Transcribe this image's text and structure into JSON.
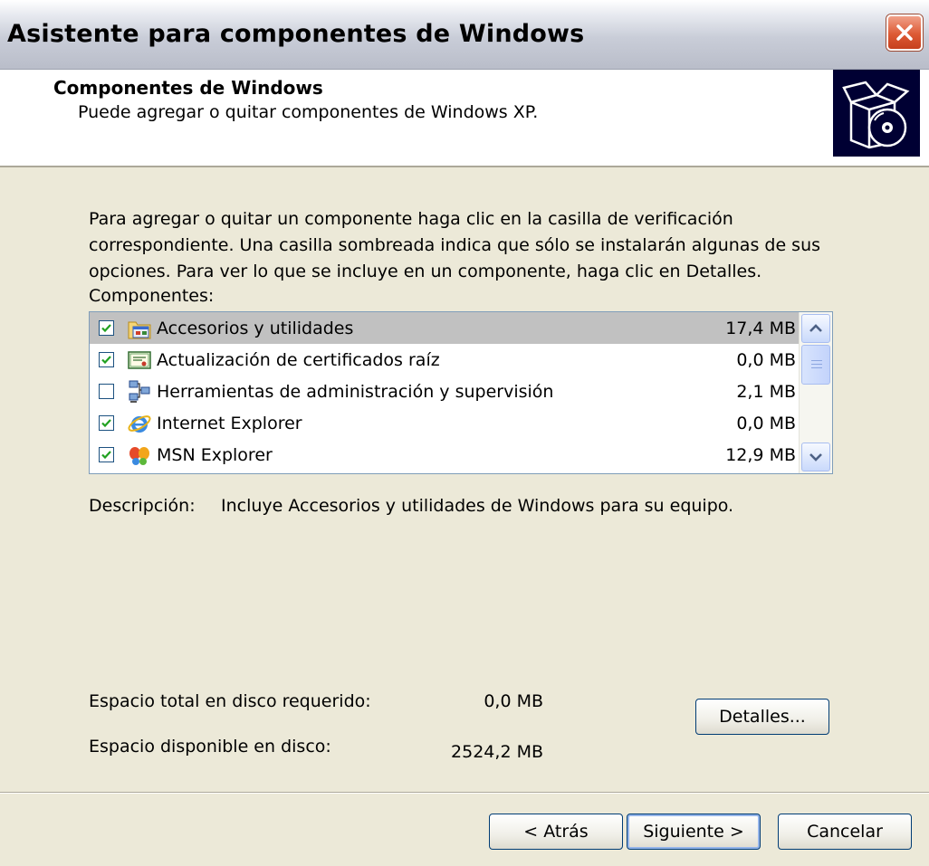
{
  "window": {
    "title": "Asistente para componentes de Windows"
  },
  "header": {
    "title": "Componentes de Windows",
    "subtitle": "Puede agregar o quitar componentes de Windows XP."
  },
  "intro_text": "Para agregar o quitar un componente haga clic en la casilla de verificación correspondiente. Una casilla sombreada indica que sólo se instalarán algunas de sus opciones. Para ver lo que se incluye en un componente, haga clic en Detalles.",
  "components_label": "Componentes:",
  "components": [
    {
      "label": "Accesorios y utilidades",
      "size": "17,4 MB",
      "checked": true,
      "selected": true,
      "icon": "accessories-icon"
    },
    {
      "label": "Actualización de certificados raíz",
      "size": "0,0 MB",
      "checked": true,
      "selected": false,
      "icon": "certificate-icon"
    },
    {
      "label": "Herramientas de administración y supervisión",
      "size": "2,1 MB",
      "checked": false,
      "selected": false,
      "icon": "network-tools-icon"
    },
    {
      "label": "Internet Explorer",
      "size": "0,0 MB",
      "checked": true,
      "selected": false,
      "icon": "internet-explorer-icon"
    },
    {
      "label": "MSN Explorer",
      "size": "12,9 MB",
      "checked": true,
      "selected": false,
      "icon": "msn-butterfly-icon"
    }
  ],
  "description": {
    "label": "Descripción:",
    "text": "Incluye Accesorios y utilidades de Windows para su equipo."
  },
  "disk": {
    "required_label": "Espacio total en disco requerido:",
    "required_value": "0,0 MB",
    "available_label": "Espacio disponible en disco:",
    "available_value": "2524,2 MB"
  },
  "buttons": {
    "details": "Detalles...",
    "back": "< Atrás",
    "next": "Siguiente >",
    "cancel": "Cancelar"
  },
  "colors": {
    "dialog_bg": "#ece9d8",
    "close_button": "#dd5a35",
    "selection": "#c1c1c1",
    "header_icon_bg": "#000033"
  }
}
